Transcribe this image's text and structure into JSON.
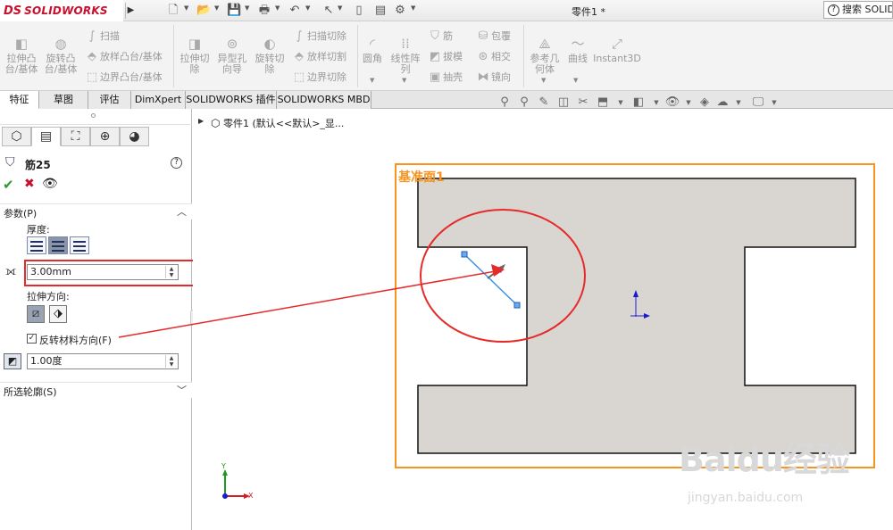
{
  "app": {
    "logo_mark": "DS",
    "logo_text": "SOLIDWORKS",
    "doc_title": "零件1 *",
    "search_label": "搜索 SOLIDWORKS"
  },
  "ribbon": {
    "extrude_boss": "拉伸凸台/基体",
    "revolve_boss": "旋转凸台/基体",
    "sweep": "扫描",
    "loft": "放样凸台/基体",
    "boundary_boss": "边界凸台/基体",
    "extrude_cut": "拉伸切除",
    "hole_wizard": "异型孔向导",
    "revolve_cut": "旋转切除",
    "swept_cut": "扫描切除",
    "lofted_cut": "放样切割",
    "boundary_cut": "边界切除",
    "fillet": "圆角",
    "linear_pattern": "线性阵列",
    "rib": "筋",
    "draft": "拔模",
    "shell": "抽壳",
    "wrap": "包覆",
    "intersect": "相交",
    "mirror": "镜向",
    "ref_geometry": "参考几何体",
    "curves": "曲线",
    "instant3d": "Instant3D"
  },
  "tabs": [
    "特征",
    "草图",
    "评估",
    "DimXpert",
    "SOLIDWORKS 插件",
    "SOLIDWORKS MBD"
  ],
  "panel": {
    "title": "筋25",
    "params_header": "参数(P)",
    "thickness_label": "厚度:",
    "thickness_value": "3.00mm",
    "extrude_dir_label": "拉伸方向:",
    "flip_label": "反转材料方向(F)",
    "flip_checked": true,
    "draft_value": "1.00度",
    "contours_header": "所选轮廓(S)"
  },
  "tree": {
    "root": "零件1  (默认<<默认>_显..."
  },
  "sketch": {
    "plane_label": "基准面1"
  },
  "axes": {
    "x": "X",
    "y": "Y"
  },
  "watermark": {
    "brand": "Baidu经验",
    "url": "jingyan.baidu.com"
  },
  "colors": {
    "plane": "#f7931e",
    "face": "#d9d5d1",
    "annotation": "#e52a2a",
    "sketch_line": "#3b8fe6",
    "logo": "#c8102e"
  }
}
